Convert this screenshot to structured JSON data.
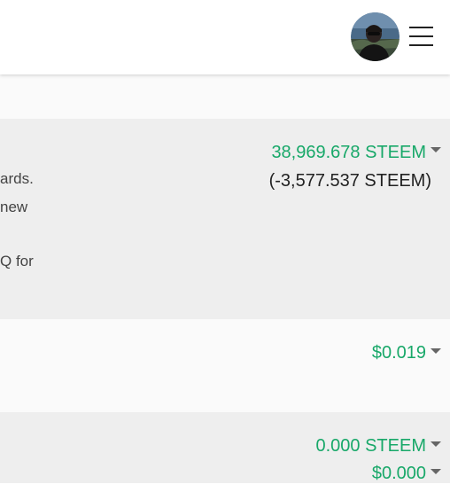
{
  "header": {
    "avatar_icon": "user-avatar",
    "menu_icon": "hamburger-menu-icon"
  },
  "steem": {
    "desc_lines": [
      "ards.",
      "new",
      "Q for"
    ],
    "balance": "38,969.678 STEEM",
    "delta": "(-3,577.537 STEEM)"
  },
  "usd": {
    "value": "$0.019"
  },
  "savings": {
    "steem": "0.000 STEEM",
    "usd": "$0.000"
  },
  "colors": {
    "accent": "#18a869",
    "band_dark": "#eeeeee",
    "band_light": "#fafafa"
  }
}
